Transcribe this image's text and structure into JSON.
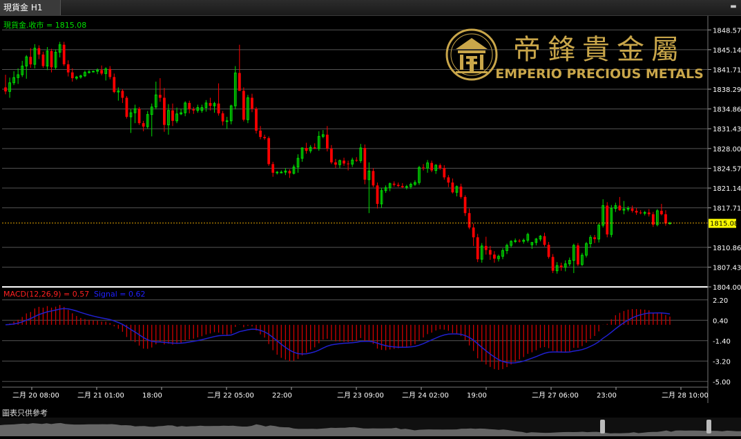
{
  "window": {
    "tab_label": "現貨金 H1"
  },
  "chart_data": {
    "type": "candlestick",
    "symbol_label": "現貨金.收市 = 1815.08",
    "last_price": "1815.08",
    "price_ticks": [
      "1848.57",
      "1845.14",
      "1841.71",
      "1838.29",
      "1834.86",
      "1831.43",
      "1828.00",
      "1824.57",
      "1821.14",
      "1817.71",
      "1810.86",
      "1807.43",
      "1804.00"
    ],
    "ylim": [
      1804.0,
      1851.0
    ],
    "x_labels": [
      "二月 20 08:00",
      "二月 21 01:00",
      "18:00",
      "二月 22 05:00",
      "22:00",
      "二月 23 09:00",
      "二月 24 02:00",
      "19:00",
      "二月 27 06:00",
      "23:00",
      "二月 28 10:00"
    ],
    "candles": [
      [
        1838.6,
        1840.8,
        1837.4,
        1837.9
      ],
      [
        1837.9,
        1840.3,
        1836.8,
        1839.4
      ],
      [
        1839.4,
        1841.4,
        1839.0,
        1840.3
      ],
      [
        1840.3,
        1841.9,
        1839.2,
        1840.8
      ],
      [
        1840.8,
        1843.2,
        1840.4,
        1842.3
      ],
      [
        1842.3,
        1844.2,
        1840.1,
        1843.9
      ],
      [
        1843.9,
        1845.4,
        1842.0,
        1842.6
      ],
      [
        1842.6,
        1846.1,
        1841.9,
        1845.4
      ],
      [
        1845.4,
        1845.9,
        1843.5,
        1844.3
      ],
      [
        1844.3,
        1844.8,
        1842.0,
        1842.3
      ],
      [
        1842.3,
        1845.6,
        1841.6,
        1844.9
      ],
      [
        1844.9,
        1845.3,
        1841.2,
        1842.1
      ],
      [
        1842.1,
        1845.2,
        1841.7,
        1844.7
      ],
      [
        1844.7,
        1846.5,
        1843.8,
        1846.0
      ],
      [
        1846.0,
        1846.5,
        1842.3,
        1842.6
      ],
      [
        1842.6,
        1843.3,
        1840.5,
        1841.2
      ],
      [
        1841.2,
        1841.9,
        1839.6,
        1840.2
      ],
      [
        1840.2,
        1840.6,
        1839.9,
        1840.4
      ],
      [
        1840.4,
        1840.8,
        1840.1,
        1840.6
      ],
      [
        1840.6,
        1841.5,
        1840.4,
        1841.2
      ],
      [
        1841.2,
        1841.6,
        1841.0,
        1841.3
      ],
      [
        1841.3,
        1841.5,
        1841.2,
        1841.4
      ],
      [
        1841.4,
        1841.9,
        1840.9,
        1841.6
      ],
      [
        1841.6,
        1842.4,
        1840.7,
        1841.0
      ],
      [
        1841.0,
        1842.1,
        1839.8,
        1841.8
      ],
      [
        1841.8,
        1842.3,
        1840.0,
        1840.4
      ],
      [
        1840.4,
        1841.0,
        1837.6,
        1837.8
      ],
      [
        1837.8,
        1838.6,
        1836.3,
        1838.0
      ],
      [
        1838.0,
        1838.3,
        1835.9,
        1836.8
      ],
      [
        1836.8,
        1837.1,
        1833.2,
        1833.5
      ],
      [
        1833.5,
        1834.8,
        1830.7,
        1834.2
      ],
      [
        1834.2,
        1835.6,
        1832.4,
        1834.9
      ],
      [
        1834.9,
        1835.2,
        1832.1,
        1832.4
      ],
      [
        1832.4,
        1832.8,
        1831.0,
        1831.8
      ],
      [
        1831.8,
        1834.5,
        1831.4,
        1833.9
      ],
      [
        1833.9,
        1835.8,
        1830.1,
        1835.2
      ],
      [
        1835.2,
        1839.6,
        1834.8,
        1837.3
      ],
      [
        1837.3,
        1840.2,
        1836.1,
        1836.8
      ],
      [
        1836.8,
        1838.5,
        1830.9,
        1832.1
      ],
      [
        1832.1,
        1835.7,
        1830.4,
        1834.6
      ],
      [
        1834.6,
        1835.8,
        1831.9,
        1832.8
      ],
      [
        1832.8,
        1835.1,
        1832.4,
        1834.0
      ],
      [
        1834.0,
        1834.9,
        1833.8,
        1834.2
      ],
      [
        1834.2,
        1836.2,
        1833.6,
        1835.9
      ],
      [
        1835.9,
        1836.3,
        1834.1,
        1834.8
      ],
      [
        1834.8,
        1835.2,
        1834.0,
        1834.6
      ],
      [
        1834.6,
        1835.6,
        1834.2,
        1835.1
      ],
      [
        1834.6,
        1835.6,
        1834.2,
        1835.1
      ],
      [
        1835.1,
        1836.4,
        1834.4,
        1835.9
      ],
      [
        1835.9,
        1836.8,
        1834.6,
        1835.4
      ],
      [
        1835.4,
        1836.1,
        1834.2,
        1835.8
      ],
      [
        1835.8,
        1839.3,
        1833.7,
        1834.1
      ],
      [
        1834.1,
        1834.5,
        1832.0,
        1832.7
      ],
      [
        1832.7,
        1833.5,
        1831.4,
        1832.8
      ],
      [
        1832.8,
        1835.6,
        1832.2,
        1835.4
      ],
      [
        1835.4,
        1842.3,
        1834.8,
        1841.1
      ],
      [
        1841.1,
        1846.0,
        1840.6,
        1838.0
      ],
      [
        1838.0,
        1838.6,
        1832.7,
        1833.0
      ],
      [
        1833.0,
        1837.3,
        1832.4,
        1836.8
      ],
      [
        1836.8,
        1837.5,
        1834.3,
        1834.9
      ],
      [
        1834.9,
        1835.2,
        1830.6,
        1831.1
      ],
      [
        1831.1,
        1831.9,
        1829.6,
        1830.0
      ],
      [
        1830.0,
        1830.4,
        1829.5,
        1829.8
      ],
      [
        1829.8,
        1830.1,
        1825.0,
        1825.3
      ],
      [
        1825.3,
        1825.7,
        1823.1,
        1823.8
      ],
      [
        1823.8,
        1824.1,
        1823.5,
        1823.9
      ],
      [
        1823.9,
        1824.2,
        1823.7,
        1823.9
      ],
      [
        1823.9,
        1824.6,
        1823.4,
        1824.1
      ],
      [
        1824.1,
        1824.4,
        1822.9,
        1823.7
      ],
      [
        1823.7,
        1825.2,
        1823.5,
        1824.8
      ],
      [
        1824.8,
        1827.0,
        1823.8,
        1826.3
      ],
      [
        1826.3,
        1828.2,
        1825.7,
        1828.1
      ],
      [
        1828.1,
        1829.0,
        1827.1,
        1827.6
      ],
      [
        1827.6,
        1828.6,
        1827.2,
        1828.2
      ],
      [
        1828.2,
        1828.9,
        1827.9,
        1828.0
      ],
      [
        1828.0,
        1831.0,
        1827.6,
        1830.1
      ],
      [
        1830.1,
        1831.2,
        1829.8,
        1830.4
      ],
      [
        1830.4,
        1831.9,
        1827.5,
        1828.0
      ],
      [
        1828.0,
        1828.6,
        1825.3,
        1825.6
      ],
      [
        1825.6,
        1826.2,
        1824.6,
        1825.2
      ],
      [
        1825.2,
        1826.1,
        1824.6,
        1825.9
      ],
      [
        1825.9,
        1826.4,
        1825.0,
        1825.4
      ],
      [
        1825.4,
        1825.9,
        1824.2,
        1825.3
      ],
      [
        1825.3,
        1826.4,
        1824.8,
        1826.0
      ],
      [
        1826.0,
        1826.5,
        1825.7,
        1825.9
      ],
      [
        1825.9,
        1828.8,
        1825.5,
        1828.1
      ],
      [
        1828.1,
        1828.7,
        1821.8,
        1822.6
      ],
      [
        1822.6,
        1825.6,
        1816.8,
        1824.1
      ],
      [
        1824.1,
        1824.6,
        1821.3,
        1821.6
      ],
      [
        1821.6,
        1822.1,
        1817.6,
        1818.4
      ],
      [
        1818.4,
        1821.2,
        1817.7,
        1820.7
      ],
      [
        1820.7,
        1821.6,
        1820.3,
        1821.2
      ],
      [
        1821.2,
        1822.1,
        1820.6,
        1821.9
      ],
      [
        1821.9,
        1822.3,
        1821.4,
        1821.7
      ],
      [
        1821.7,
        1822.1,
        1821.3,
        1821.5
      ],
      [
        1821.5,
        1822.0,
        1821.1,
        1821.3
      ],
      [
        1821.3,
        1821.7,
        1820.9,
        1821.4
      ],
      [
        1821.4,
        1822.1,
        1821.0,
        1821.8
      ],
      [
        1821.8,
        1822.5,
        1821.5,
        1822.1
      ],
      [
        1822.1,
        1825.0,
        1821.7,
        1824.7
      ],
      [
        1824.7,
        1825.3,
        1824.2,
        1824.6
      ],
      [
        1824.6,
        1826.0,
        1823.8,
        1825.5
      ],
      [
        1825.5,
        1825.9,
        1823.9,
        1824.2
      ],
      [
        1824.2,
        1825.3,
        1823.6,
        1825.1
      ],
      [
        1825.1,
        1825.4,
        1824.3,
        1824.6
      ],
      [
        1824.6,
        1825.1,
        1822.6,
        1823.0
      ],
      [
        1823.0,
        1823.4,
        1821.3,
        1822.1
      ],
      [
        1822.1,
        1822.8,
        1820.2,
        1820.4
      ],
      [
        1820.4,
        1821.6,
        1819.7,
        1821.4
      ],
      [
        1821.4,
        1821.9,
        1819.3,
        1819.6
      ],
      [
        1819.6,
        1819.9,
        1816.3,
        1816.8
      ],
      [
        1816.8,
        1817.6,
        1814.0,
        1814.3
      ],
      [
        1814.3,
        1815.0,
        1811.1,
        1812.6
      ],
      [
        1812.6,
        1813.2,
        1808.3,
        1808.8
      ],
      [
        1808.8,
        1811.6,
        1808.2,
        1811.1
      ],
      [
        1811.1,
        1812.7,
        1809.6,
        1810.4
      ],
      [
        1810.4,
        1811.1,
        1808.7,
        1809.6
      ],
      [
        1809.6,
        1810.2,
        1808.2,
        1808.9
      ],
      [
        1808.9,
        1809.6,
        1808.4,
        1809.3
      ],
      [
        1809.3,
        1810.7,
        1808.8,
        1810.3
      ],
      [
        1810.3,
        1811.5,
        1809.7,
        1811.2
      ],
      [
        1811.2,
        1812.1,
        1810.8,
        1811.9
      ],
      [
        1811.9,
        1812.4,
        1811.6,
        1812.0
      ],
      [
        1812.0,
        1812.3,
        1811.7,
        1811.9
      ],
      [
        1811.9,
        1812.4,
        1811.5,
        1812.1
      ],
      [
        1812.1,
        1813.4,
        1811.7,
        1813.1
      ],
      [
        1811.3,
        1811.8,
        1810.6,
        1811.7
      ],
      [
        1811.7,
        1812.5,
        1811.2,
        1812.3
      ],
      [
        1812.3,
        1813.0,
        1811.9,
        1812.8
      ],
      [
        1812.8,
        1813.4,
        1811.0,
        1811.3
      ],
      [
        1811.3,
        1811.8,
        1808.9,
        1809.2
      ],
      [
        1809.2,
        1809.7,
        1806.4,
        1806.8
      ],
      [
        1806.8,
        1808.3,
        1806.3,
        1807.7
      ],
      [
        1807.7,
        1808.2,
        1806.8,
        1807.4
      ],
      [
        1807.4,
        1808.6,
        1806.7,
        1808.0
      ],
      [
        1808.0,
        1809.1,
        1807.6,
        1808.6
      ],
      [
        1808.6,
        1811.5,
        1806.4,
        1811.2
      ],
      [
        1811.2,
        1811.6,
        1807.6,
        1807.9
      ],
      [
        1807.9,
        1809.9,
        1807.6,
        1809.5
      ],
      [
        1809.5,
        1811.8,
        1809.1,
        1811.5
      ],
      [
        1811.5,
        1813.0,
        1810.8,
        1812.6
      ],
      [
        1812.6,
        1813.0,
        1811.6,
        1812.3
      ],
      [
        1812.3,
        1815.0,
        1811.7,
        1814.7
      ],
      [
        1814.7,
        1819.2,
        1814.3,
        1818.1
      ],
      [
        1818.1,
        1818.7,
        1812.6,
        1813.1
      ],
      [
        1813.1,
        1818.2,
        1812.6,
        1817.6
      ],
      [
        1817.6,
        1818.6,
        1817.0,
        1818.1
      ],
      [
        1818.1,
        1819.6,
        1817.2,
        1817.3
      ],
      [
        1817.3,
        1818.9,
        1816.6,
        1817.5
      ],
      [
        1817.5,
        1818.0,
        1817.1,
        1817.6
      ],
      [
        1817.6,
        1818.1,
        1816.9,
        1817.2
      ],
      [
        1817.2,
        1817.7,
        1816.5,
        1816.9
      ],
      [
        1816.9,
        1817.3,
        1816.6,
        1816.8
      ],
      [
        1816.8,
        1817.2,
        1816.4,
        1816.9
      ],
      [
        1816.9,
        1817.5,
        1816.2,
        1816.6
      ],
      [
        1816.6,
        1817.0,
        1814.4,
        1814.8
      ],
      [
        1814.8,
        1817.5,
        1814.5,
        1817.2
      ],
      [
        1817.2,
        1818.4,
        1816.4,
        1816.6
      ],
      [
        1816.6,
        1817.3,
        1814.6,
        1815.0
      ],
      [
        1815.0,
        1815.3,
        1814.8,
        1815.08
      ]
    ],
    "macd": {
      "label": "MACD(12,26,9) = 0.57",
      "signal_label": "Signal = 0.62",
      "ticks": [
        "2.20",
        "0.40",
        "-1.40",
        "-3.20",
        "-5.00"
      ],
      "ylim": [
        -5.5,
        3.1
      ]
    }
  },
  "logo": {
    "chinese": "帝鋒貴金屬",
    "english": "EMPERIO PRECIOUS METALS"
  },
  "footer": {
    "note": "圖表只供參考"
  },
  "colors": {
    "up": "#00e000",
    "down": "#ff0000",
    "grid": "#555555",
    "macd_hist": "#d00000",
    "signal": "#2020d0",
    "gold": "#c9a64a",
    "price_tag": "#ffff00"
  }
}
